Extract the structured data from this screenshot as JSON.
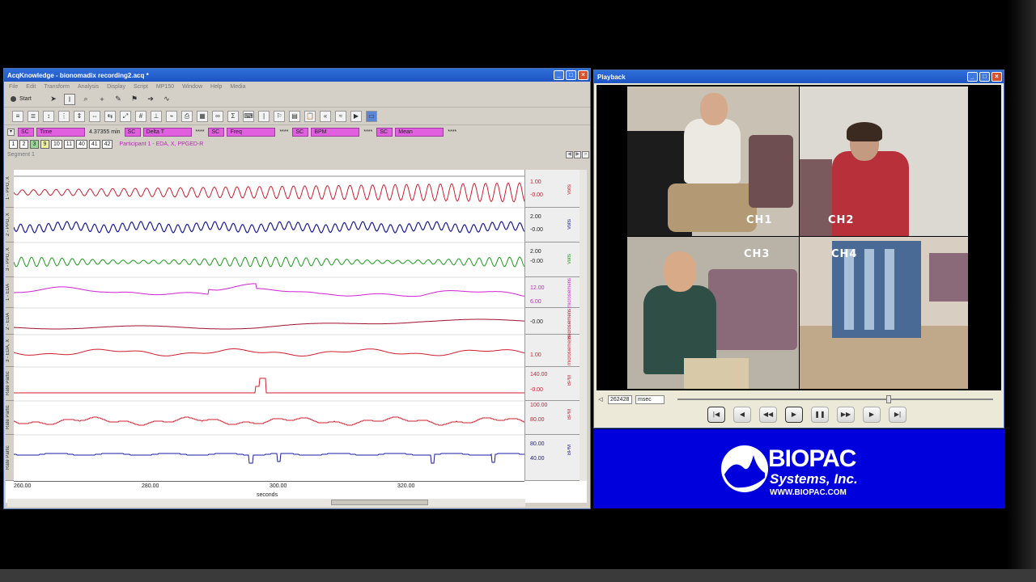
{
  "acq": {
    "title": "AcqKnowledge - bionomadix recording2.acq *",
    "menu": [
      "File",
      "Edit",
      "Transform",
      "Analysis",
      "Display",
      "Script",
      "MP150",
      "Window",
      "Help",
      "Media"
    ],
    "start_label": "Start",
    "measurements": [
      {
        "ch": "SC",
        "fn": "Time",
        "value": "4.37355 min"
      },
      {
        "ch": "SC",
        "fn": "Delta T",
        "value": "****"
      },
      {
        "ch": "SC",
        "fn": "Freq",
        "value": "****"
      },
      {
        "ch": "SC",
        "fn": "BPM",
        "value": "****"
      },
      {
        "ch": "SC",
        "fn": "Mean",
        "value": "****"
      }
    ],
    "channel_buttons": [
      "1",
      "2",
      "3",
      "9",
      "10",
      "11",
      "40",
      "41",
      "42"
    ],
    "graph_title": "Participant 1 - EDA, X, PPGED-R",
    "segment": "Segment 1",
    "channels": [
      {
        "label": "1 - PPG, X",
        "hi": "1.00",
        "lo": "-0.00",
        "unit": "Volts",
        "color": "#d01c2c"
      },
      {
        "label": "2 - PPG, X",
        "hi": "2.00",
        "lo": "-0.00",
        "unit": "Volts",
        "color": "#1a1a9a"
      },
      {
        "label": "3 - PPG, X",
        "hi": "2.00",
        "lo": "-0.00",
        "unit": "Volts",
        "color": "#1a9a1a"
      },
      {
        "label": "1 - EDA",
        "hi": "12.00",
        "lo": "6.00",
        "unit": "microsiemens",
        "color": "#d020d0"
      },
      {
        "label": "2 - EDA",
        "hi": "",
        "lo": "-0.00",
        "unit": "microsiemens",
        "color": "#a01030"
      },
      {
        "label": "3 - EDA, X",
        "hi": "",
        "lo": "1.00",
        "unit": "microsiemens",
        "color": "#d01c2c"
      },
      {
        "label": "Rate Partic",
        "hi": "140.00",
        "lo": "-0.00",
        "unit": "BPM",
        "color": "#d01c2c"
      },
      {
        "label": "Rate Partic",
        "hi": "100.00",
        "lo": "80.00",
        "unit": "BPM",
        "color": "#d01c2c"
      },
      {
        "label": "Rate Partic",
        "hi": "80.00",
        "lo": "40.00",
        "unit": "BPM",
        "color": "#1a1aa0"
      }
    ],
    "time_ticks": [
      "260.00",
      "280.00",
      "300.00",
      "320.00"
    ],
    "time_unit": "seconds"
  },
  "playback": {
    "title": "Playback",
    "quadrants": [
      "CH1",
      "CH2",
      "CH3",
      "CH4"
    ],
    "position": "262428",
    "units": "msec"
  },
  "logo": {
    "name": "BIOPAC",
    "sub": "Systems, Inc.",
    "url": "WWW.BIOPAC.COM"
  }
}
